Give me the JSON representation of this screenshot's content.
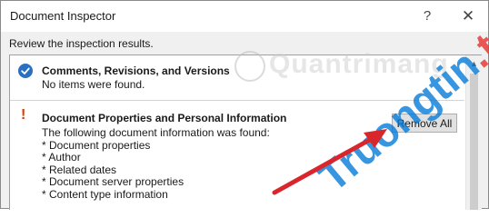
{
  "dialog": {
    "title": "Document Inspector",
    "help_glyph": "?",
    "close_glyph": "✕",
    "subtitle": "Review the inspection results."
  },
  "sections": [
    {
      "status": "clean",
      "status_icon": "check-circle-icon",
      "heading": "Comments, Revisions, and Versions",
      "text": "No items were found."
    },
    {
      "status": "issues-found",
      "status_icon": "exclamation-icon",
      "status_glyph": "!",
      "heading": "Document Properties and Personal Information",
      "text": "The following document information was found:",
      "items": [
        "* Document properties",
        "* Author",
        "* Related dates",
        "* Document server properties",
        "* Content type information"
      ],
      "button_label": "Remove All"
    }
  ],
  "scrollbar": {
    "up_glyph": "▲"
  },
  "watermark": {
    "name": "Quantrimang",
    "site": "Truongtin",
    "tld": ".top"
  },
  "colors": {
    "check_blue": "#2b6fc1",
    "warning_orange": "#d83b01",
    "arrow_red": "#d9262c",
    "watermark_blue": "#0078d7",
    "watermark_red": "#e83c38"
  }
}
